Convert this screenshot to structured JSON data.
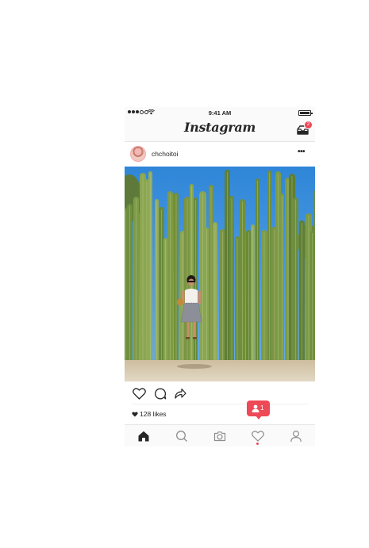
{
  "status_bar": {
    "time": "9:41 AM"
  },
  "nav": {
    "title": "Instagram",
    "inbox_badge": "2"
  },
  "post": {
    "username": "chchoitoi",
    "more": "•••",
    "likes": "128 likes"
  },
  "notification": {
    "count": "1"
  },
  "icons": {
    "signal": "signal-dots-icon",
    "wifi": "wifi-icon",
    "battery": "battery-icon",
    "inbox": "inbox-icon",
    "like": "heart-icon",
    "comment": "comment-icon",
    "share": "share-icon",
    "home": "home-icon",
    "search": "search-icon",
    "camera": "camera-icon",
    "activity": "heart-icon",
    "profile": "profile-icon"
  },
  "colors": {
    "accent": "#ed4956",
    "text": "#262626",
    "bar": "#fafafa"
  }
}
